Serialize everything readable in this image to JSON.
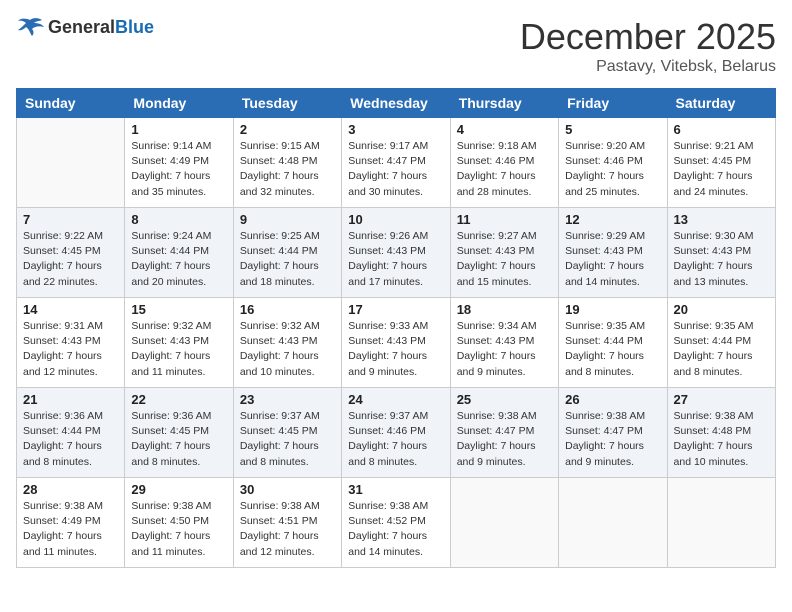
{
  "logo": {
    "general": "General",
    "blue": "Blue"
  },
  "title": "December 2025",
  "location": "Pastavy, Vitebsk, Belarus",
  "days_of_week": [
    "Sunday",
    "Monday",
    "Tuesday",
    "Wednesday",
    "Thursday",
    "Friday",
    "Saturday"
  ],
  "weeks": [
    [
      {
        "day": "",
        "info": ""
      },
      {
        "day": "1",
        "info": "Sunrise: 9:14 AM\nSunset: 4:49 PM\nDaylight: 7 hours\nand 35 minutes."
      },
      {
        "day": "2",
        "info": "Sunrise: 9:15 AM\nSunset: 4:48 PM\nDaylight: 7 hours\nand 32 minutes."
      },
      {
        "day": "3",
        "info": "Sunrise: 9:17 AM\nSunset: 4:47 PM\nDaylight: 7 hours\nand 30 minutes."
      },
      {
        "day": "4",
        "info": "Sunrise: 9:18 AM\nSunset: 4:46 PM\nDaylight: 7 hours\nand 28 minutes."
      },
      {
        "day": "5",
        "info": "Sunrise: 9:20 AM\nSunset: 4:46 PM\nDaylight: 7 hours\nand 25 minutes."
      },
      {
        "day": "6",
        "info": "Sunrise: 9:21 AM\nSunset: 4:45 PM\nDaylight: 7 hours\nand 24 minutes."
      }
    ],
    [
      {
        "day": "7",
        "info": "Sunrise: 9:22 AM\nSunset: 4:45 PM\nDaylight: 7 hours\nand 22 minutes."
      },
      {
        "day": "8",
        "info": "Sunrise: 9:24 AM\nSunset: 4:44 PM\nDaylight: 7 hours\nand 20 minutes."
      },
      {
        "day": "9",
        "info": "Sunrise: 9:25 AM\nSunset: 4:44 PM\nDaylight: 7 hours\nand 18 minutes."
      },
      {
        "day": "10",
        "info": "Sunrise: 9:26 AM\nSunset: 4:43 PM\nDaylight: 7 hours\nand 17 minutes."
      },
      {
        "day": "11",
        "info": "Sunrise: 9:27 AM\nSunset: 4:43 PM\nDaylight: 7 hours\nand 15 minutes."
      },
      {
        "day": "12",
        "info": "Sunrise: 9:29 AM\nSunset: 4:43 PM\nDaylight: 7 hours\nand 14 minutes."
      },
      {
        "day": "13",
        "info": "Sunrise: 9:30 AM\nSunset: 4:43 PM\nDaylight: 7 hours\nand 13 minutes."
      }
    ],
    [
      {
        "day": "14",
        "info": "Sunrise: 9:31 AM\nSunset: 4:43 PM\nDaylight: 7 hours\nand 12 minutes."
      },
      {
        "day": "15",
        "info": "Sunrise: 9:32 AM\nSunset: 4:43 PM\nDaylight: 7 hours\nand 11 minutes."
      },
      {
        "day": "16",
        "info": "Sunrise: 9:32 AM\nSunset: 4:43 PM\nDaylight: 7 hours\nand 10 minutes."
      },
      {
        "day": "17",
        "info": "Sunrise: 9:33 AM\nSunset: 4:43 PM\nDaylight: 7 hours\nand 9 minutes."
      },
      {
        "day": "18",
        "info": "Sunrise: 9:34 AM\nSunset: 4:43 PM\nDaylight: 7 hours\nand 9 minutes."
      },
      {
        "day": "19",
        "info": "Sunrise: 9:35 AM\nSunset: 4:44 PM\nDaylight: 7 hours\nand 8 minutes."
      },
      {
        "day": "20",
        "info": "Sunrise: 9:35 AM\nSunset: 4:44 PM\nDaylight: 7 hours\nand 8 minutes."
      }
    ],
    [
      {
        "day": "21",
        "info": "Sunrise: 9:36 AM\nSunset: 4:44 PM\nDaylight: 7 hours\nand 8 minutes."
      },
      {
        "day": "22",
        "info": "Sunrise: 9:36 AM\nSunset: 4:45 PM\nDaylight: 7 hours\nand 8 minutes."
      },
      {
        "day": "23",
        "info": "Sunrise: 9:37 AM\nSunset: 4:45 PM\nDaylight: 7 hours\nand 8 minutes."
      },
      {
        "day": "24",
        "info": "Sunrise: 9:37 AM\nSunset: 4:46 PM\nDaylight: 7 hours\nand 8 minutes."
      },
      {
        "day": "25",
        "info": "Sunrise: 9:38 AM\nSunset: 4:47 PM\nDaylight: 7 hours\nand 9 minutes."
      },
      {
        "day": "26",
        "info": "Sunrise: 9:38 AM\nSunset: 4:47 PM\nDaylight: 7 hours\nand 9 minutes."
      },
      {
        "day": "27",
        "info": "Sunrise: 9:38 AM\nSunset: 4:48 PM\nDaylight: 7 hours\nand 10 minutes."
      }
    ],
    [
      {
        "day": "28",
        "info": "Sunrise: 9:38 AM\nSunset: 4:49 PM\nDaylight: 7 hours\nand 11 minutes."
      },
      {
        "day": "29",
        "info": "Sunrise: 9:38 AM\nSunset: 4:50 PM\nDaylight: 7 hours\nand 11 minutes."
      },
      {
        "day": "30",
        "info": "Sunrise: 9:38 AM\nSunset: 4:51 PM\nDaylight: 7 hours\nand 12 minutes."
      },
      {
        "day": "31",
        "info": "Sunrise: 9:38 AM\nSunset: 4:52 PM\nDaylight: 7 hours\nand 14 minutes."
      },
      {
        "day": "",
        "info": ""
      },
      {
        "day": "",
        "info": ""
      },
      {
        "day": "",
        "info": ""
      }
    ]
  ]
}
